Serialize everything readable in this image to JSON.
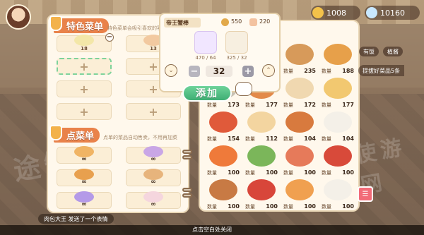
{
  "hud": {
    "gold": "1008",
    "gems": "10160"
  },
  "left_panel": {
    "featured": {
      "title": "特色菜单",
      "hint": "特色菜单会吸引喜欢的客",
      "slots": [
        {
          "qty": "18",
          "filled": true,
          "color": "#f3e7a8"
        },
        {
          "qty": "13",
          "filled": true,
          "color": "#f2c9a0"
        },
        {
          "label": "+"
        },
        {
          "label": "+"
        },
        {
          "label": "+"
        },
        {
          "label": "+"
        },
        {
          "label": "+"
        },
        {
          "label": "+"
        }
      ]
    },
    "alacarte": {
      "title": "点菜单",
      "hint": "点单的菜品自动售卖，不用再加菜",
      "slots": [
        {
          "inf": "∞",
          "color": "#f0b464"
        },
        {
          "inf": "∞",
          "color": "#c9a6e6"
        },
        {
          "inf": "∞",
          "color": "#e8a04e"
        },
        {
          "inf": "∞",
          "color": "#e7b47c"
        },
        {
          "inf": "∞",
          "color": "#b49ae8"
        },
        {
          "inf": "∞",
          "color": "#f5d6de"
        }
      ]
    }
  },
  "popup": {
    "dish_name": "帝王蟹棒",
    "coins": "550",
    "stars": "220",
    "ingredients": [
      {
        "have": "470 / 64",
        "color": "#bba3e0"
      },
      {
        "have": "325 / 32",
        "color": "#e8d2b0"
      }
    ],
    "quantity": "32",
    "minus": "−",
    "plus": "+",
    "add_label": "添加"
  },
  "right_panel": {
    "tags": [
      "有饭",
      "植酱"
    ],
    "side_label": "提拔好菜品5条",
    "qty_label": "数量",
    "cells": [
      {
        "count": "",
        "color": "#e9a867"
      },
      {
        "count": "",
        "color": "#f1b44c"
      },
      {
        "count": "235",
        "color": "#d79a5a"
      },
      {
        "count": "188",
        "color": "#e7a04a"
      },
      {
        "count": "173",
        "color": "#c8c2b4"
      },
      {
        "count": "177",
        "color": "#e28a4a"
      },
      {
        "count": "172",
        "color": "#f0d8b0"
      },
      {
        "count": "177",
        "color": "#f2c870"
      },
      {
        "count": "154",
        "color": "#e05a3a"
      },
      {
        "count": "112",
        "color": "#f3d5a0"
      },
      {
        "count": "104",
        "color": "#d87a3e"
      },
      {
        "count": "104",
        "color": "#f4f0e8"
      },
      {
        "count": "100",
        "color": "#ef7a3a"
      },
      {
        "count": "100",
        "color": "#7bb65a"
      },
      {
        "count": "100",
        "color": "#e67a5a"
      },
      {
        "count": "100",
        "color": "#d84a3a"
      },
      {
        "count": "100",
        "color": "#c87a44"
      },
      {
        "count": "100",
        "color": "#d8463a"
      },
      {
        "count": "100",
        "color": "#f0a050"
      },
      {
        "count": "100",
        "color": "#f4f0e8"
      }
    ]
  },
  "toast": "肉包大王 发送了一个表情",
  "close_hint": "点击空白处关闭",
  "watermarks": [
    "途知网",
    "天使游戏网"
  ]
}
